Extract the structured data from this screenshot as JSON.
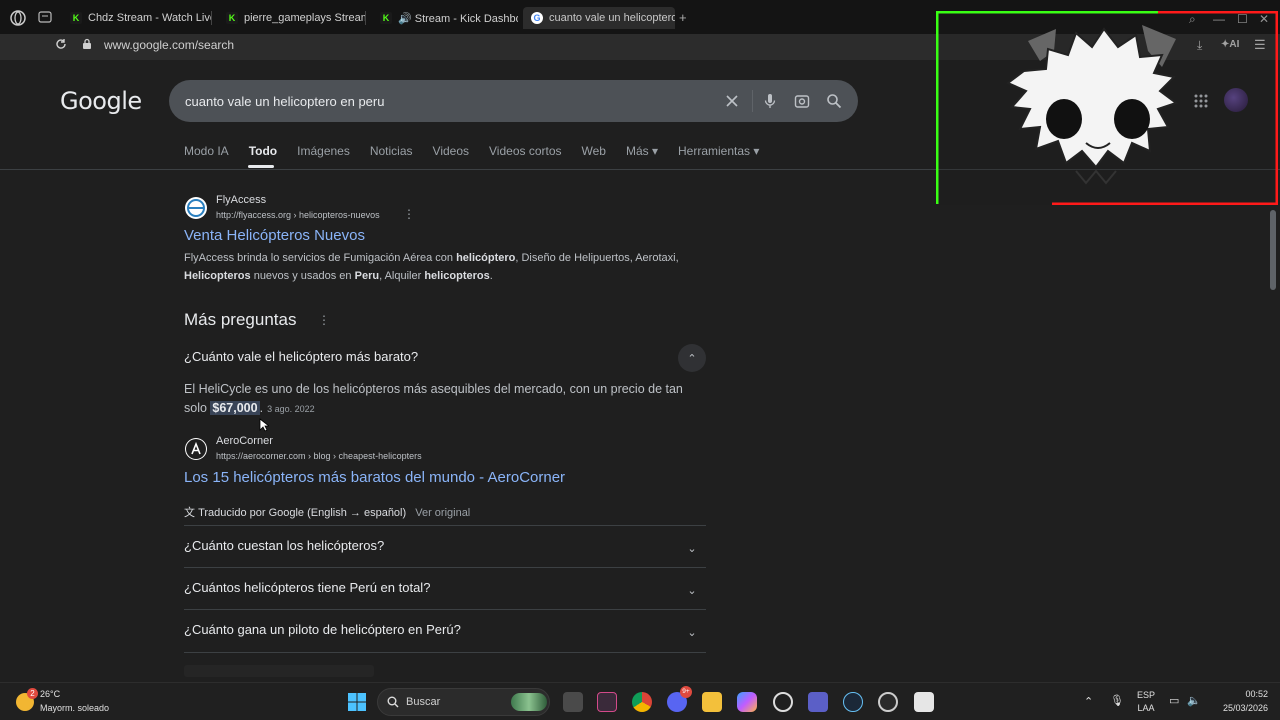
{
  "browser": {
    "tabs": [
      {
        "label": "Chdz Stream - Watch Live",
        "favicon": "kick-icon"
      },
      {
        "label": "pierre_gameplays Stream",
        "favicon": "kick-icon"
      },
      {
        "label": "🔊 Stream - Kick Dashbo",
        "favicon": "kick-icon"
      },
      {
        "label": "cuanto vale un helicoptero",
        "favicon": "google-icon"
      }
    ],
    "url": "www.google.com/search",
    "toolbar_ai": "AI"
  },
  "google": {
    "logo": "Google",
    "query": "cuanto vale un helicoptero en peru",
    "tabs": [
      "Modo IA",
      "Todo",
      "Imágenes",
      "Noticias",
      "Videos",
      "Videos cortos",
      "Web",
      "Más ▾",
      "Herramientas ▾"
    ],
    "active_tab": "Todo"
  },
  "result1": {
    "site_name": "FlyAccess",
    "site_url": "http://flyaccess.org › helicopteros-nuevos",
    "title": "Venta Helicópteros Nuevos",
    "snippet_parts": [
      "FlyAccess brinda lo servicios de Fumigación Aérea con ",
      "helicóptero",
      ", Diseño de Helipuertos, Aerotaxi, ",
      "Helicopteros",
      " nuevos y usados en ",
      "Peru",
      ", Alquiler ",
      "helicopteros",
      "."
    ]
  },
  "paa": {
    "heading": "Más preguntas",
    "expanded_question": "¿Cuánto vale el helicóptero más barato?",
    "answer_text": "El HeliCycle es uno de los helicópteros más asequibles del mercado, con un precio de tan solo ",
    "answer_highlight": "$67,000",
    "answer_end": ".",
    "answer_date": "3 ago. 2022",
    "source_name": "AeroCorner",
    "source_url": "https://aerocorner.com › blog › cheapest-helicopters",
    "source_title": "Los 15 helicópteros más baratos del mundo - AeroCorner",
    "translated": "Traducido por Google (English → español)",
    "see_original": "Ver original",
    "questions": [
      "¿Cuánto cuestan los helicópteros?",
      "¿Cuántos helicópteros tiene Perú en total?",
      "¿Cuánto gana un piloto de helicóptero en Perú?"
    ]
  },
  "taskbar": {
    "temperature": "26°C",
    "weather": "Mayorm. soleado",
    "weather_badge": "2",
    "search_label": "Buscar",
    "lang_top": "ESP",
    "lang_bottom": "LAA",
    "time": "00:52",
    "date": "25/03/2026",
    "discord_badge": "9+"
  },
  "colors": {
    "link": "#8ab4f8",
    "overlay_green": "#39ff14",
    "overlay_red": "#ff1a1a"
  }
}
